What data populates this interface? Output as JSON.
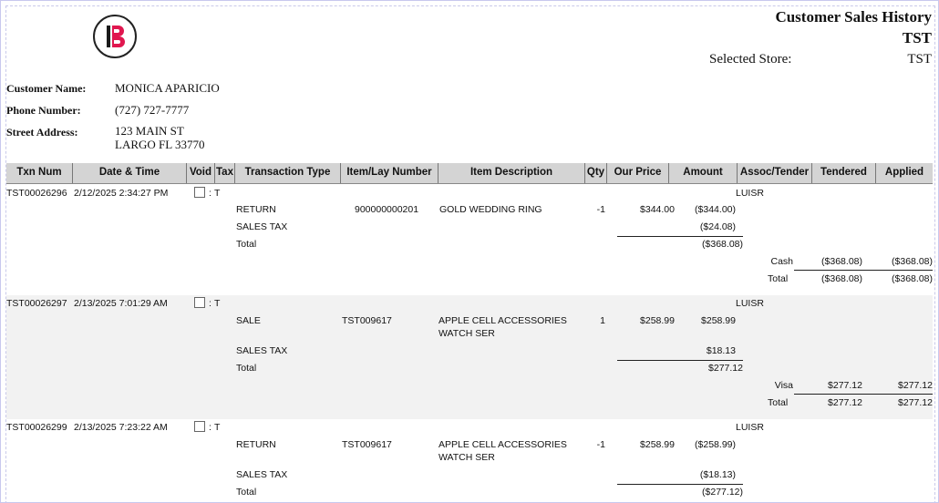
{
  "report": {
    "title": "Customer Sales History",
    "subtitle": "TST",
    "selected_store_label": "Selected Store:",
    "selected_store_value": "TST",
    "logo_icon": "b-logo-icon"
  },
  "customer": {
    "name_label": "Customer Name:",
    "name_value": "MONICA APARICIO",
    "phone_label": "Phone Number:",
    "phone_value": "(727) 727-7777",
    "address_label": "Street Address:",
    "address_line1": "123 MAIN ST",
    "address_line2": "LARGO FL 33770"
  },
  "columns": [
    "Txn Num",
    "Date & Time",
    "Void",
    "Tax",
    "Transaction Type",
    "Item/Lay Number",
    "Item Description",
    "Qty",
    "Our Price",
    "Amount",
    "Assoc/Tender",
    "Tendered",
    "Applied"
  ],
  "transactions": [
    {
      "txn_num": "TST00026296",
      "datetime": "2/12/2025 2:34:27 PM",
      "void": false,
      "tax": "T",
      "assoc": "LUISR",
      "item": {
        "type": "RETURN",
        "number": "900000000201",
        "desc1": "GOLD WEDDING RING",
        "desc2": "",
        "qty": "-1",
        "price": "$344.00",
        "amount": "($344.00)"
      },
      "tax_line": {
        "label": "SALES TAX",
        "amount": "($24.08)"
      },
      "total_line": {
        "label": "Total",
        "amount": "($368.08)"
      },
      "tender": {
        "method": "Cash",
        "tendered": "($368.08)",
        "applied": "($368.08)"
      },
      "tender_total": {
        "label": "Total",
        "tendered": "($368.08)",
        "applied": "($368.08)"
      }
    },
    {
      "txn_num": "TST00026297",
      "datetime": "2/13/2025 7:01:29 AM",
      "void": false,
      "tax": "T",
      "assoc": "LUISR",
      "item": {
        "type": "SALE",
        "number": "TST009617",
        "desc1": "APPLE CELL ACCESSORIES",
        "desc2": "WATCH SER",
        "qty": "1",
        "price": "$258.99",
        "amount": "$258.99"
      },
      "tax_line": {
        "label": "SALES TAX",
        "amount": "$18.13"
      },
      "total_line": {
        "label": "Total",
        "amount": "$277.12"
      },
      "tender": {
        "method": "Visa",
        "tendered": "$277.12",
        "applied": "$277.12"
      },
      "tender_total": {
        "label": "Total",
        "tendered": "$277.12",
        "applied": "$277.12"
      }
    },
    {
      "txn_num": "TST00026299",
      "datetime": "2/13/2025 7:23:22 AM",
      "void": false,
      "tax": "T",
      "assoc": "LUISR",
      "item": {
        "type": "RETURN",
        "number": "TST009617",
        "desc1": "APPLE CELL ACCESSORIES",
        "desc2": "WATCH SER",
        "qty": "-1",
        "price": "$258.99",
        "amount": "($258.99)"
      },
      "tax_line": {
        "label": "SALES TAX",
        "amount": "($18.13)"
      },
      "total_line": {
        "label": "Total",
        "amount": "($277.12)"
      }
    }
  ]
}
